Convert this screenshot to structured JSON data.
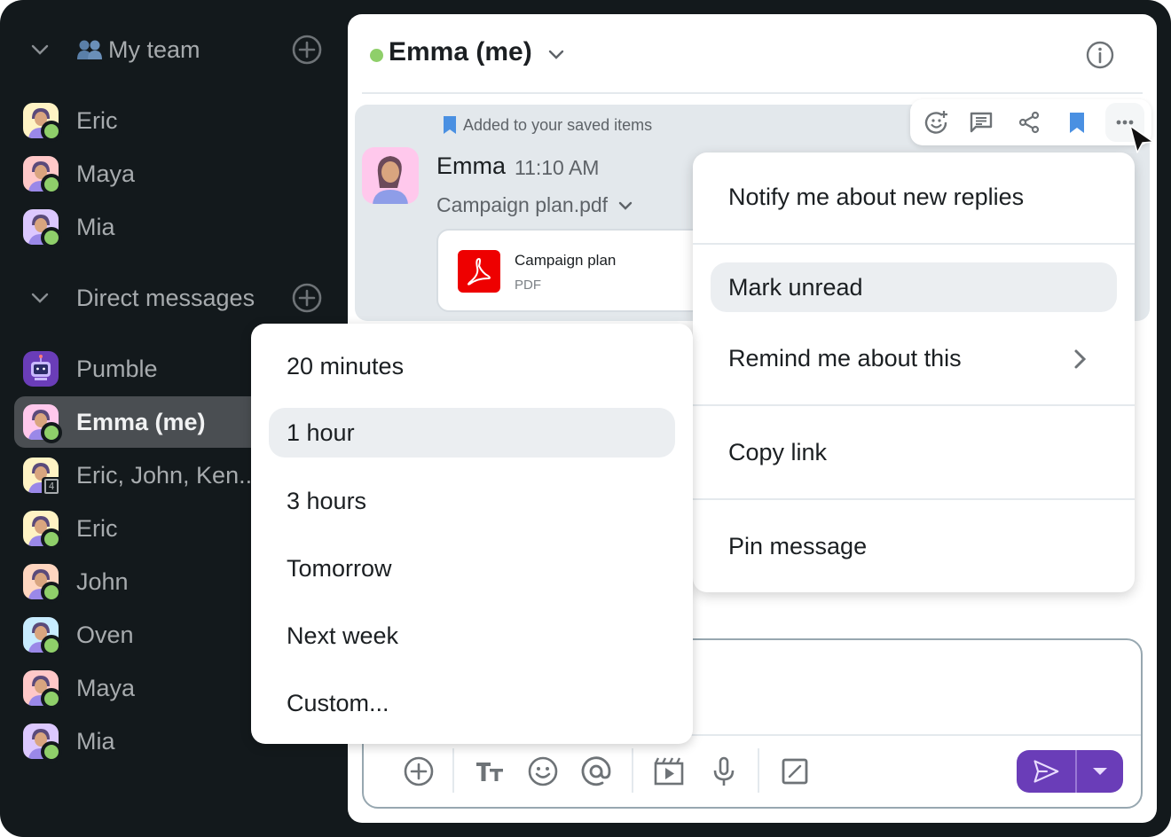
{
  "sidebar": {
    "my_team": {
      "title": "My team",
      "icon": "people-emoji-icon",
      "members": [
        {
          "name": "Eric",
          "avatar_bg": "#fff3c4",
          "status": "online"
        },
        {
          "name": "Maya",
          "avatar_bg": "#ffc8c8",
          "status": "online"
        },
        {
          "name": "Mia",
          "avatar_bg": "#dcc8ff",
          "status": "online"
        }
      ]
    },
    "direct_messages": {
      "title": "Direct messages",
      "items": [
        {
          "name": "Pumble",
          "avatar_bg": "#6a3db8",
          "status": "none"
        },
        {
          "name": "Emma (me)",
          "avatar_bg": "#ffc8ec",
          "status": "online",
          "active": true
        },
        {
          "name": "Eric, John, Ken...",
          "avatar_bg": "#fff3c4",
          "group_count": "4"
        },
        {
          "name": "Eric",
          "avatar_bg": "#fff3c4",
          "status": "online"
        },
        {
          "name": "John",
          "avatar_bg": "#ffd6c0",
          "status": "online"
        },
        {
          "name": "Oven",
          "avatar_bg": "#c8ecff",
          "status": "online"
        },
        {
          "name": "Maya",
          "avatar_bg": "#ffc8c8",
          "status": "online"
        },
        {
          "name": "Mia",
          "avatar_bg": "#dcc8ff",
          "status": "online"
        }
      ]
    }
  },
  "channel": {
    "title": "Emma (me)",
    "status_color": "#8fcf6a"
  },
  "message": {
    "saved_note": "Added to your saved items",
    "author": "Emma",
    "time": "11:10 AM",
    "file_label": "Campaign plan.pdf",
    "attachment": {
      "name": "Campaign plan",
      "type": "PDF"
    }
  },
  "message_toolbar": {
    "actions": [
      "add-reaction",
      "reply-in-thread",
      "share",
      "saved-bookmark",
      "more-actions"
    ]
  },
  "context_menu": {
    "items": [
      {
        "label": "Notify me about new replies"
      },
      {
        "label": "Mark unread",
        "highlighted": true
      },
      {
        "label": "Remind me about this",
        "has_submenu": true
      },
      {
        "label": "Copy link"
      },
      {
        "label": "Pin message"
      }
    ]
  },
  "remind_submenu": {
    "items": [
      {
        "label": "20 minutes"
      },
      {
        "label": "1 hour",
        "highlighted": true
      },
      {
        "label": "3 hours"
      },
      {
        "label": "Tomorrow"
      },
      {
        "label": "Next week"
      },
      {
        "label": "Custom..."
      }
    ]
  },
  "composer": {
    "value": "",
    "tools": [
      "attach",
      "text-format",
      "emoji",
      "mention",
      "video-clip",
      "voice-message",
      "slash-command"
    ]
  },
  "colors": {
    "accent": "#6a3db8",
    "online": "#8fcf6a",
    "saved": "#4a90e2",
    "pdf": "#ee0000",
    "sidebar_bg": "#13191c"
  }
}
